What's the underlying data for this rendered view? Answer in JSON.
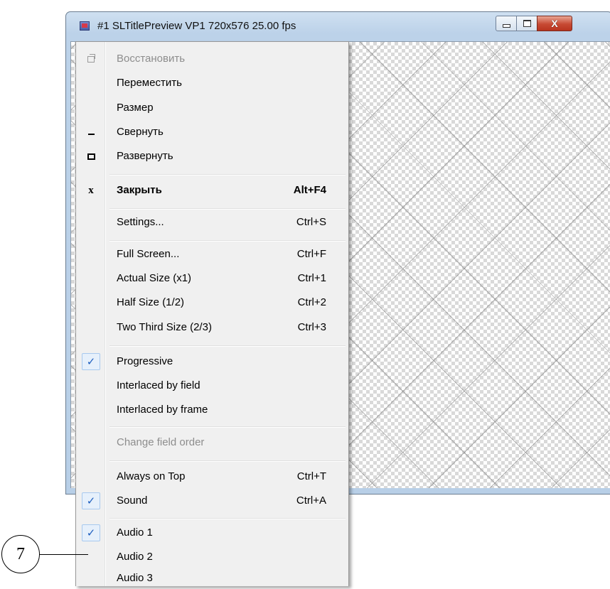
{
  "window": {
    "title": "#1 SLTitlePreview VP1 720x576 25.00 fps",
    "controls": {
      "minimize_icon": "minimize-icon",
      "maximize_icon": "maximize-icon",
      "close_glyph": "X"
    }
  },
  "system_menu": {
    "items": [
      {
        "label": "Восстановить",
        "shortcut": "",
        "icon": "restore-icon"
      },
      {
        "label": "Переместить",
        "shortcut": "",
        "icon": ""
      },
      {
        "label": "Размер",
        "shortcut": "",
        "icon": ""
      },
      {
        "label": "Свернуть",
        "shortcut": "",
        "icon": "minimize-icon"
      },
      {
        "label": "Развернуть",
        "shortcut": "",
        "icon": "maximize-icon"
      },
      {
        "label": "Закрыть",
        "shortcut": "Alt+F4",
        "icon": "close-icon"
      },
      {
        "label": "Settings...",
        "shortcut": "Ctrl+S",
        "icon": ""
      },
      {
        "label": "Full Screen...",
        "shortcut": "Ctrl+F",
        "icon": ""
      },
      {
        "label": "Actual Size (x1)",
        "shortcut": "Ctrl+1",
        "icon": ""
      },
      {
        "label": "Half Size (1/2)",
        "shortcut": "Ctrl+2",
        "icon": ""
      },
      {
        "label": "Two Third Size (2/3)",
        "shortcut": "Ctrl+3",
        "icon": ""
      },
      {
        "label": "Progressive",
        "shortcut": "",
        "icon": "checkmark-icon",
        "checked": true
      },
      {
        "label": "Interlaced by field",
        "shortcut": "",
        "icon": ""
      },
      {
        "label": "Interlaced by frame",
        "shortcut": "",
        "icon": ""
      },
      {
        "label": "Change field order",
        "shortcut": "",
        "icon": ""
      },
      {
        "label": "Always on Top",
        "shortcut": "Ctrl+T",
        "icon": ""
      },
      {
        "label": "Sound",
        "shortcut": "Ctrl+A",
        "icon": "checkmark-icon",
        "checked": true
      },
      {
        "label": "Audio 1",
        "shortcut": "",
        "icon": "checkmark-icon",
        "checked": true
      },
      {
        "label": "Audio 2",
        "shortcut": "",
        "icon": ""
      },
      {
        "label": "Audio 3",
        "shortcut": "",
        "icon": ""
      }
    ]
  },
  "callout": {
    "number": "7"
  },
  "colors": {
    "checkmark": "#1f5fbf",
    "disabled_text": "#8d8d8d",
    "close_button": "#c74a33"
  }
}
